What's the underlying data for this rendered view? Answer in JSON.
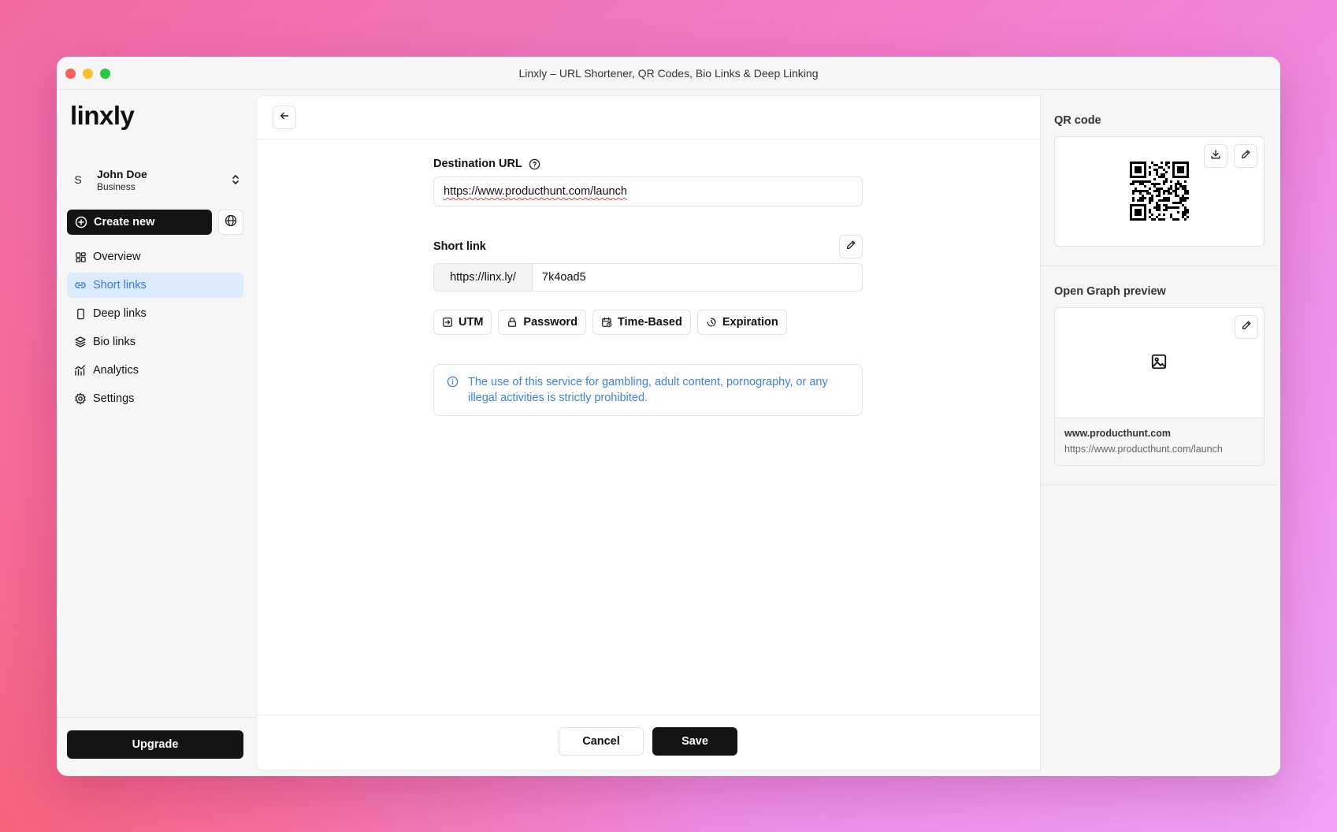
{
  "window": {
    "title": "Linxly – URL Shortener, QR Codes, Bio Links & Deep Linking"
  },
  "sidebar": {
    "logo": "linxly",
    "user": {
      "initial": "S",
      "name": "John Doe",
      "plan": "Business"
    },
    "create_label": "Create new",
    "items": [
      {
        "label": "Overview",
        "icon": "grid-icon"
      },
      {
        "label": "Short links",
        "icon": "link-icon",
        "active": true
      },
      {
        "label": "Deep links",
        "icon": "phone-icon"
      },
      {
        "label": "Bio links",
        "icon": "layers-icon"
      },
      {
        "label": "Analytics",
        "icon": "chart-icon"
      },
      {
        "label": "Settings",
        "icon": "gear-icon"
      }
    ],
    "upgrade_label": "Upgrade"
  },
  "form": {
    "destination_label": "Destination URL",
    "destination_value": "https://www.producthunt.com/launch",
    "short_link_label": "Short link",
    "short_prefix": "https://linx.ly/",
    "short_slug": "7k4oad5",
    "options": [
      "UTM",
      "Password",
      "Time-Based",
      "Expiration"
    ],
    "notice": "The use of this service for gambling, adult content, pornography, or any illegal activities is strictly prohibited."
  },
  "footer": {
    "cancel_label": "Cancel",
    "save_label": "Save"
  },
  "right_panel": {
    "qr_title": "QR code",
    "og_title": "Open Graph preview",
    "og_domain": "www.producthunt.com",
    "og_url": "https://www.producthunt.com/launch"
  },
  "colors": {
    "accent": "#2f79d9",
    "active_bg": "#dcebfb",
    "primary_button": "#141414",
    "notice_text": "#3b82d6"
  }
}
